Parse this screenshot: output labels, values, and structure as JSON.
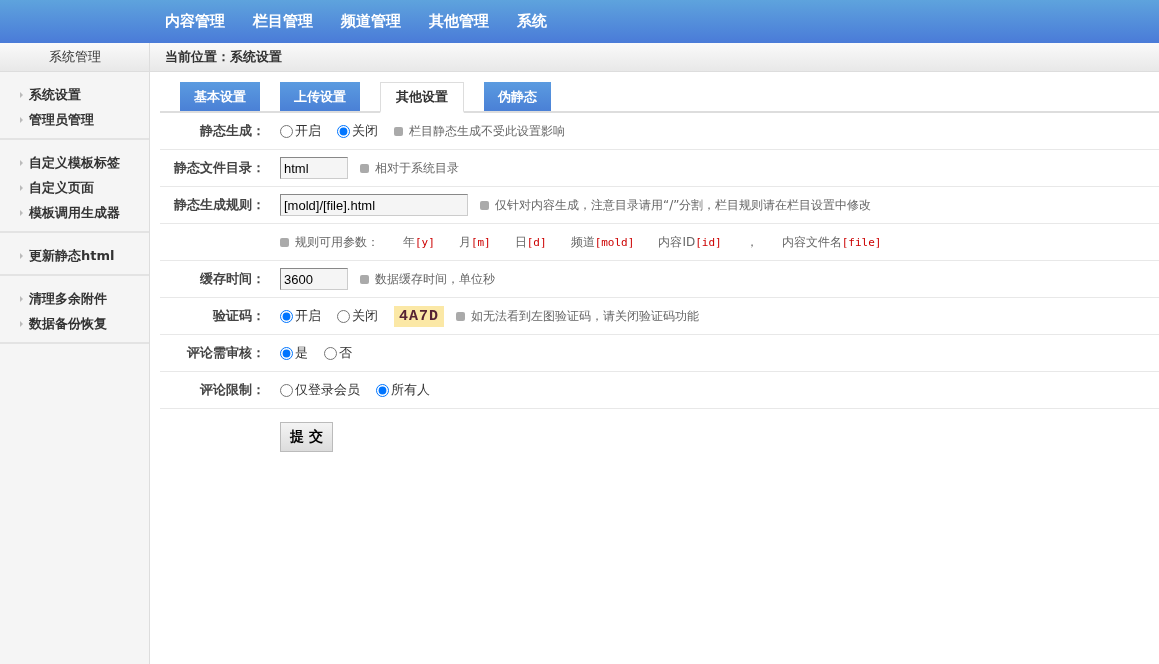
{
  "top_nav": [
    {
      "label": "内容管理"
    },
    {
      "label": "栏目管理"
    },
    {
      "label": "频道管理"
    },
    {
      "label": "其他管理"
    },
    {
      "label": "系统"
    }
  ],
  "sidebar": {
    "title": "系统管理",
    "groups": [
      {
        "items": [
          {
            "label": "系统设置"
          },
          {
            "label": "管理员管理"
          }
        ]
      },
      {
        "items": [
          {
            "label": "自定义模板标签"
          },
          {
            "label": "自定义页面"
          },
          {
            "label": "模板调用生成器"
          }
        ]
      },
      {
        "items": [
          {
            "label": "更新静态html"
          }
        ]
      },
      {
        "items": [
          {
            "label": "清理多余附件"
          },
          {
            "label": "数据备份恢复"
          }
        ]
      }
    ]
  },
  "breadcrumb": "当前位置：系统设置",
  "tabs": [
    {
      "label": "基本设置",
      "selected": false
    },
    {
      "label": "上传设置",
      "selected": false
    },
    {
      "label": "其他设置",
      "selected": true
    },
    {
      "label": "伪静态",
      "selected": false
    }
  ],
  "rows": [
    {
      "kind": "radio",
      "label": "静态生成：",
      "options": [
        {
          "label": "开启",
          "selected": false
        },
        {
          "label": "关闭",
          "selected": true
        }
      ],
      "hint": "栏目静态生成不受此设置影响"
    },
    {
      "kind": "input",
      "label": "静态文件目录：",
      "value": "html",
      "hint": "相对于系统目录"
    },
    {
      "kind": "input",
      "label": "静态生成规则：",
      "value": "[mold]/[file].html",
      "hint": "仅针对内容生成，注意目录请用“/”分割，栏目规则请在栏目设置中修改"
    },
    {
      "kind": "params",
      "hint": "规则可用参数：",
      "params": [
        {
          "text": "年",
          "code": "[y]"
        },
        {
          "text": "月",
          "code": "[m]"
        },
        {
          "text": "日",
          "code": "[d]"
        },
        {
          "text": "频道",
          "code": "[mold]"
        },
        {
          "text": "内容ID",
          "code": "[id]"
        },
        {
          "text": "，"
        },
        {
          "text": "内容文件名",
          "code": "[file]"
        }
      ]
    },
    {
      "kind": "input",
      "label": "缓存时间：",
      "value": "3600",
      "hint": "数据缓存时间，单位秒"
    },
    {
      "kind": "captcha",
      "label": "验证码：",
      "options": [
        {
          "label": "开启",
          "selected": true
        },
        {
          "label": "关闭",
          "selected": false
        }
      ],
      "captcha": "4A7D",
      "hint": "如无法看到左图验证码，请关闭验证码功能"
    },
    {
      "kind": "radio",
      "label": "评论需审核：",
      "options": [
        {
          "label": "是",
          "selected": true
        },
        {
          "label": "否",
          "selected": false
        }
      ]
    },
    {
      "kind": "radio",
      "label": "评论限制：",
      "options": [
        {
          "label": "仅登录会员",
          "selected": false
        },
        {
          "label": "所有人",
          "selected": true
        }
      ]
    }
  ],
  "submit": "提 交"
}
